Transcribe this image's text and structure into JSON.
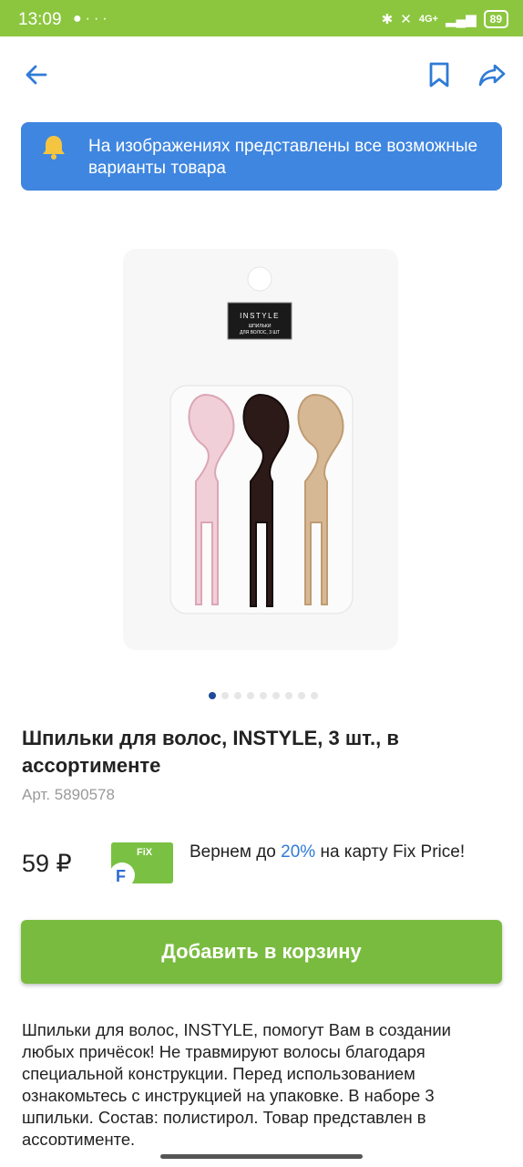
{
  "status_bar": {
    "time": "13:09",
    "battery": "89",
    "network": "4G+"
  },
  "banner": {
    "text": "На изображениях представлены все возможные варианты товара"
  },
  "product_image": {
    "brand": "INSTYLE",
    "label_line1": "ШПИЛЬКИ",
    "label_line2": "ДЛЯ ВОЛОС, 3 ШТ"
  },
  "carousel": {
    "page_count": 9,
    "active_index": 0
  },
  "product": {
    "title": "Шпильки для волос, INSTYLE, 3 шт., в ассортименте",
    "article": "Арт. 5890578",
    "price": "59 ₽"
  },
  "cashback": {
    "prefix": "Вернем до",
    "percent": "20%",
    "suffix": "на карту Fix Price!",
    "card_logo_text": "FiX"
  },
  "cart": {
    "add_label": "Добавить в корзину"
  },
  "description": "Шпильки для волос, INSTYLE, помогут Вам в создании любых причёсок! Не травмируют волосы благодаря специальной конструкции. Перед использованием ознакомьтесь с инструкцией на упаковке. В наборе 3 шпильки. Состав: полистирол. Товар представлен в ассортименте.",
  "colors": {
    "status_bar": "#8cc63f",
    "accent_blue": "#3f86e0",
    "button_green": "#79bb3f",
    "icon_blue": "#2f7bd6"
  }
}
